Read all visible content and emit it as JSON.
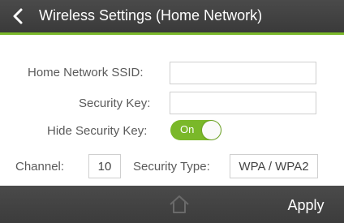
{
  "header": {
    "title": "Wireless Settings (Home Network)",
    "back_icon": "chevron-left-icon",
    "accent_color": "#7ab829"
  },
  "form": {
    "ssid_label": "Home Network SSID:",
    "ssid_value": "",
    "key_label": "Security Key:",
    "key_value": "",
    "hide_key_label": "Hide Security Key:",
    "hide_key_toggle": "On",
    "channel_label": "Channel:",
    "channel_value": "10",
    "security_type_label": "Security Type:",
    "security_type_value": "WPA / WPA2"
  },
  "footer": {
    "home_icon": "home-icon",
    "apply_label": "Apply"
  }
}
